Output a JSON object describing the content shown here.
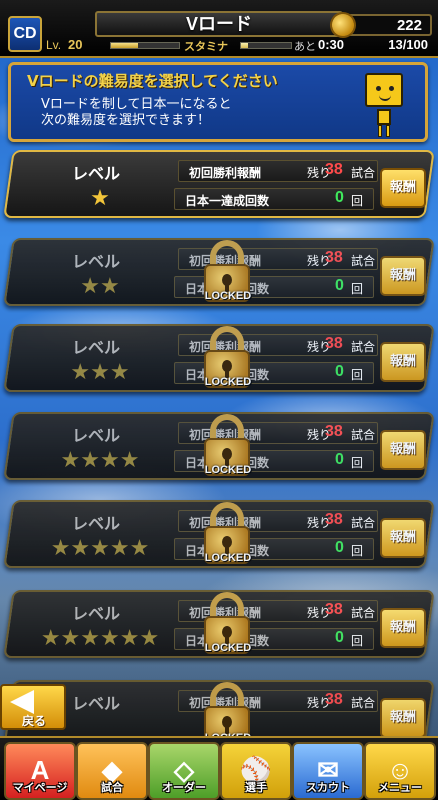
{
  "header": {
    "team_logo": "CD",
    "title": "Vロード",
    "coins": "222",
    "level_label": "Lv.",
    "level": "20",
    "stamina_label": "スタミナ",
    "remain_label": "あと",
    "remain_time": "0:30",
    "stamina": "13/100"
  },
  "info": {
    "title": "Vロードの難易度を選択してください",
    "text_line1": "Vロードを制して日本一になると",
    "text_line2": "次の難易度を選択できます！"
  },
  "levels": [
    {
      "label": "レベル",
      "stars": "★",
      "reward_label": "初回勝利報酬",
      "remain": "残り",
      "games_left": "38",
      "games_unit": "試合",
      "champ_label": "日本一達成回数",
      "champ_count": "0",
      "champ_unit": "回",
      "button": "報酬",
      "locked": false
    },
    {
      "label": "レベル",
      "stars": "★★",
      "reward_label": "初回勝利報酬",
      "remain": "残り",
      "games_left": "38",
      "games_unit": "試合",
      "champ_label": "日本一達成回数",
      "champ_count": "0",
      "champ_unit": "回",
      "button": "報酬",
      "locked": true
    },
    {
      "label": "レベル",
      "stars": "★★★",
      "reward_label": "初回勝利報酬",
      "remain": "残り",
      "games_left": "38",
      "games_unit": "試合",
      "champ_label": "日本一達成回数",
      "champ_count": "0",
      "champ_unit": "回",
      "button": "報酬",
      "locked": true
    },
    {
      "label": "レベル",
      "stars": "★★★★",
      "reward_label": "初回勝利報酬",
      "remain": "残り",
      "games_left": "38",
      "games_unit": "試合",
      "champ_label": "日本一達成回数",
      "champ_count": "0",
      "champ_unit": "回",
      "button": "報酬",
      "locked": true
    },
    {
      "label": "レベル",
      "stars": "★★★★★",
      "reward_label": "初回勝利報酬",
      "remain": "残り",
      "games_left": "38",
      "games_unit": "試合",
      "champ_label": "日本一達成回数",
      "champ_count": "0",
      "champ_unit": "回",
      "button": "報酬",
      "locked": true
    },
    {
      "label": "レベル",
      "stars": "★★★★★★",
      "reward_label": "初回勝利報酬",
      "remain": "残り",
      "games_left": "38",
      "games_unit": "試合",
      "champ_label": "日本一達成回数",
      "champ_count": "0",
      "champ_unit": "回",
      "button": "報酬",
      "locked": true
    },
    {
      "label": "レベル",
      "stars": "",
      "reward_label": "初回勝利報酬",
      "remain": "残り",
      "games_left": "38",
      "games_unit": "試合",
      "champ_label": "",
      "champ_count": "",
      "champ_unit": "",
      "button": "報酬",
      "locked": true
    }
  ],
  "lock_text": "LOCKED",
  "back_button": "戻る",
  "nav": {
    "mypage": "マイページ",
    "game": "試合",
    "order": "オーダー",
    "player": "選手",
    "scout": "スカウト",
    "menu": "メニュー"
  },
  "icons": {
    "coin": "coin-icon",
    "lock": "padlock-icon",
    "back": "arrow-left-icon"
  },
  "colors": {
    "accent_gold": "#e0b844",
    "games_left_red": "#ff4b4b",
    "count_green": "#3fe85c"
  }
}
